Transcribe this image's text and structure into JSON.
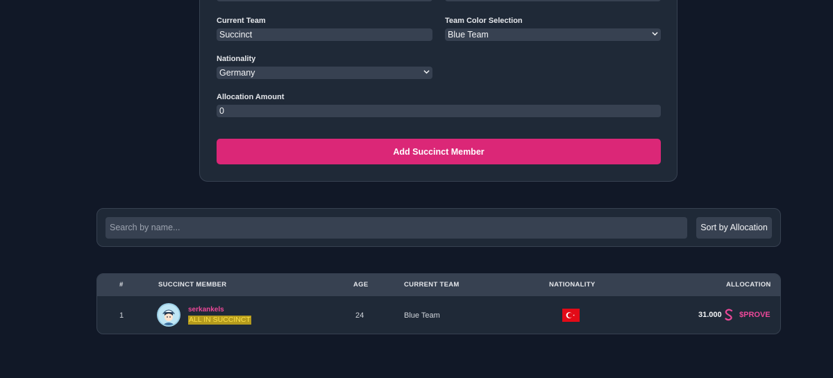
{
  "form": {
    "current_team_label": "Current Team",
    "current_team_value": "Succinct",
    "team_color_label": "Team Color Selection",
    "team_color_value": "Blue Team",
    "nationality_label": "Nationality",
    "nationality_value": "Germany",
    "allocation_label": "Allocation Amount",
    "allocation_value": "0",
    "submit_label": "Add Succinct Member"
  },
  "search": {
    "placeholder": "Search by name...",
    "sort_label": "Sort by Allocation"
  },
  "table": {
    "headers": {
      "rank": "#",
      "member": "SUCCINCT MEMBER",
      "age": "AGE",
      "team": "CURRENT TEAM",
      "nationality": "NATIONALITY",
      "allocation": "ALLOCATION"
    },
    "rows": [
      {
        "rank": "1",
        "name": "serkankels",
        "tag": "ALL IN SUCCINCT",
        "age": "24",
        "team": "Blue Team",
        "flag_icon": "turkey-flag-icon",
        "allocation": "31.000",
        "token": "$PROVE"
      }
    ]
  },
  "colors": {
    "background": "#111827",
    "card": "#1f2937",
    "accent": "#db2777",
    "token_pink": "#ec4899"
  }
}
